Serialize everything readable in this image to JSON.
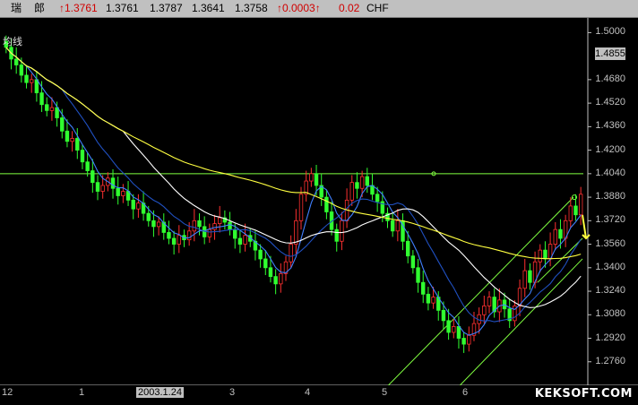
{
  "header": {
    "symbol_a": "瑞",
    "symbol_b": "郎",
    "last": "1.3761",
    "open": "1.3761",
    "high": "1.3787",
    "low": "1.3641",
    "close": "1.3758",
    "change": "0.0003",
    "change_pct": "0.02",
    "currency": "CHF",
    "up_color": "#d00000"
  },
  "indicator_label": "均线",
  "current_price": "1.4855",
  "watermark": "KEKSOFT.COM",
  "chart_data": {
    "type": "candlestick",
    "title": "",
    "ylim": [
      1.26,
      1.51
    ],
    "y_ticks": [
      "1.5000",
      "1.4680",
      "1.4520",
      "1.4360",
      "1.4200",
      "1.4040",
      "1.3880",
      "1.3720",
      "1.3560",
      "1.3400",
      "1.3240",
      "1.3080",
      "1.2920",
      "1.2760"
    ],
    "x_tick_labels": [
      "12",
      "1",
      "2003.1.24",
      "3",
      "4",
      "5",
      "6"
    ],
    "horizontal_line": 1.404,
    "colors": {
      "up": "#ff3030",
      "down": "#30ff30",
      "ma_short": "#4080ff",
      "ma_mid": "#ffffff",
      "ma_long": "#ffff40",
      "channel": "#80ff40"
    },
    "closes": [
      1.49,
      1.482,
      1.478,
      1.471,
      1.466,
      1.468,
      1.459,
      1.451,
      1.447,
      1.449,
      1.442,
      1.433,
      1.426,
      1.428,
      1.42,
      1.412,
      1.406,
      1.398,
      1.392,
      1.396,
      1.401,
      1.394,
      1.389,
      1.392,
      1.386,
      1.38,
      1.384,
      1.377,
      1.372,
      1.368,
      1.371,
      1.364,
      1.36,
      1.356,
      1.362,
      1.359,
      1.365,
      1.372,
      1.368,
      1.361,
      1.366,
      1.37,
      1.374,
      1.371,
      1.366,
      1.36,
      1.356,
      1.362,
      1.358,
      1.352,
      1.346,
      1.34,
      1.334,
      1.329,
      1.336,
      1.344,
      1.356,
      1.372,
      1.39,
      1.399,
      1.404,
      1.396,
      1.388,
      1.378,
      1.366,
      1.358,
      1.372,
      1.386,
      1.398,
      1.394,
      1.402,
      1.396,
      1.39,
      1.385,
      1.377,
      1.372,
      1.365,
      1.372,
      1.358,
      1.348,
      1.34,
      1.33,
      1.322,
      1.316,
      1.32,
      1.311,
      1.304,
      1.296,
      1.3,
      1.292,
      1.288,
      1.294,
      1.302,
      1.308,
      1.314,
      1.32,
      1.31,
      1.318,
      1.312,
      1.304,
      1.314,
      1.326,
      1.338,
      1.33,
      1.344,
      1.352,
      1.346,
      1.356,
      1.366,
      1.36,
      1.372,
      1.382,
      1.376,
      1.39
    ]
  }
}
